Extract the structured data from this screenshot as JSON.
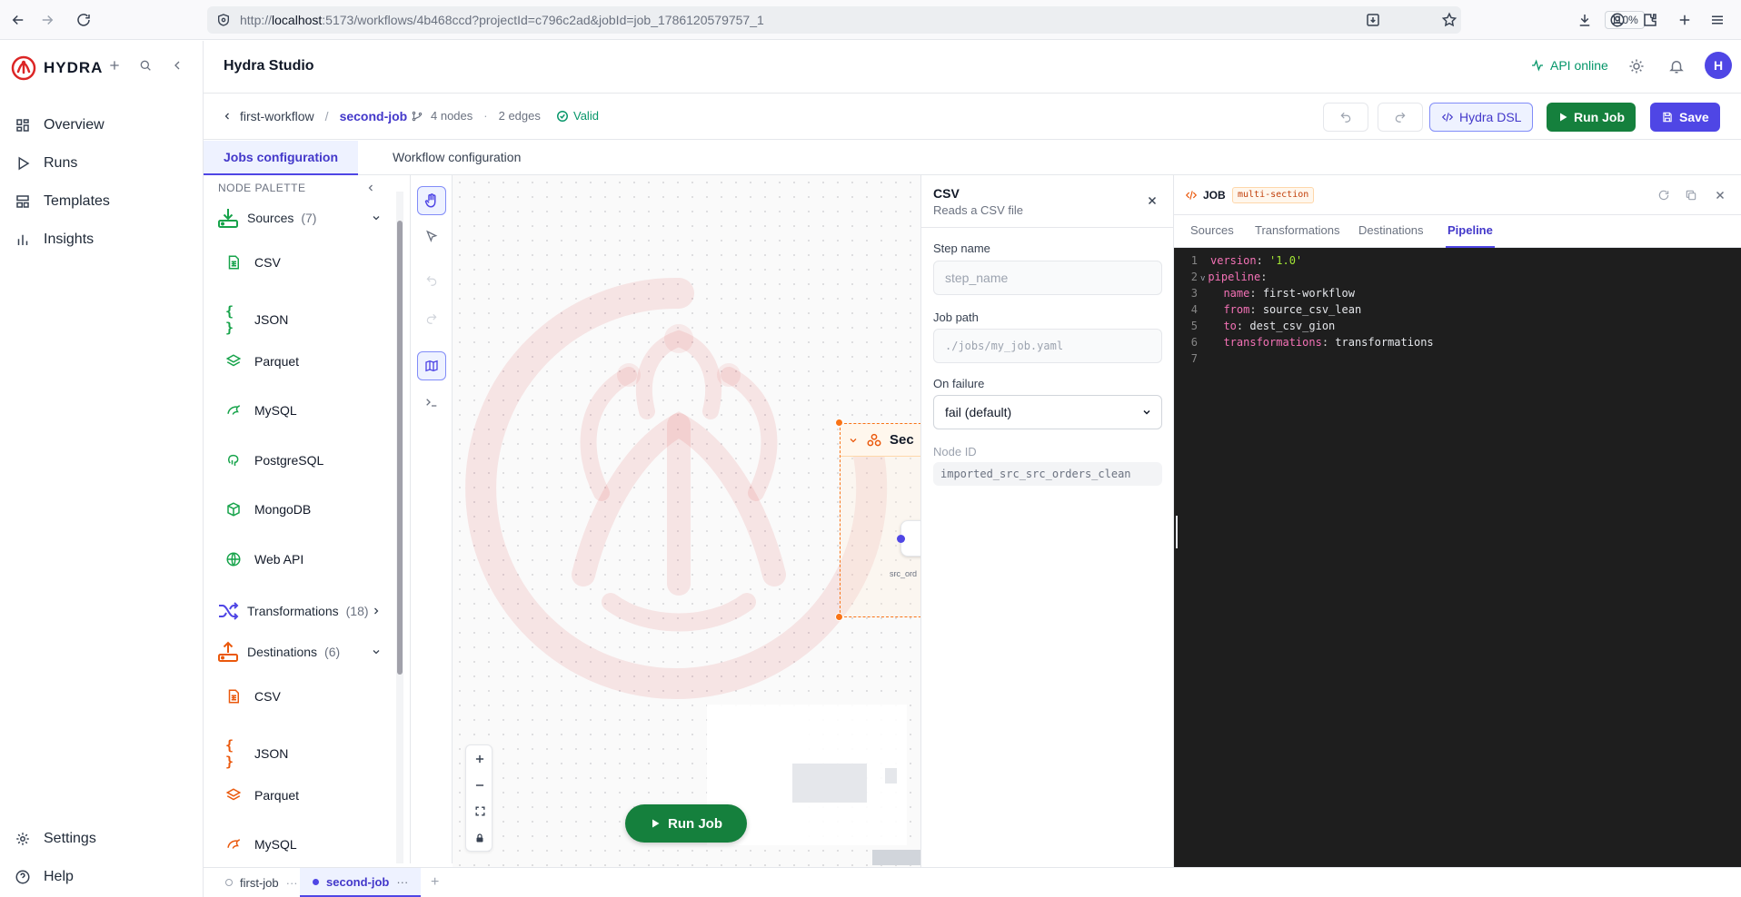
{
  "browser": {
    "url_prefix": "http://",
    "url_host": "localhost",
    "url_rest": ":5173/workflows/4b468ccd?projectId=c796c2ad&jobId=job_1786120579757_1",
    "zoom": "110%"
  },
  "sidebar": {
    "brand": "HYDRA",
    "items": [
      {
        "label": "Overview",
        "icon": "grid-icon"
      },
      {
        "label": "Runs",
        "icon": "play-icon"
      },
      {
        "label": "Templates",
        "icon": "layout-icon"
      },
      {
        "label": "Insights",
        "icon": "bar-chart-icon"
      }
    ],
    "bottom_items": [
      {
        "label": "Settings",
        "icon": "gear-icon"
      },
      {
        "label": "Help",
        "icon": "help-icon"
      }
    ]
  },
  "header": {
    "title": "Hydra Studio",
    "api_status": "API online",
    "avatar_initial": "H"
  },
  "toolbar": {
    "workflow": "first-workflow",
    "separator": "/",
    "job": "second-job",
    "nodes": "4 nodes",
    "dot": "·",
    "edges": "2 edges",
    "status": "Valid",
    "dsl_label": "Hydra DSL",
    "run_label": "Run Job",
    "save_label": "Save"
  },
  "tabs": {
    "jobs": "Jobs configuration",
    "workflow": "Workflow configuration"
  },
  "palette": {
    "title": "NODE PALETTE",
    "sources_label": "Sources",
    "sources_count": "(7)",
    "sources": [
      "CSV",
      "JSON",
      "Parquet",
      "MySQL",
      "PostgreSQL",
      "MongoDB",
      "Web API"
    ],
    "transformations_label": "Transformations",
    "transformations_count": "(18)",
    "destinations_label": "Destinations",
    "destinations_count": "(6)",
    "destinations": [
      "CSV",
      "JSON",
      "Parquet",
      "MySQL"
    ]
  },
  "canvas": {
    "group_title": "Sec",
    "inner_label": "src_ord",
    "run_label": "Run Job",
    "colors": {
      "group_border": "#f97316",
      "run_button": "#15803d"
    }
  },
  "props": {
    "title": "CSV",
    "subtitle": "Reads a CSV file",
    "step_name_label": "Step name",
    "step_name_placeholder": "step_name",
    "job_path_label": "Job path",
    "job_path_placeholder": "./jobs/my_job.yaml",
    "on_failure_label": "On failure",
    "on_failure_value": "fail (default)",
    "node_id_label": "Node ID",
    "node_id_value": "imported_src_src_orders_clean"
  },
  "code": {
    "title": "JOB",
    "badge": "multi-section",
    "tabs": [
      "Sources",
      "Transformations",
      "Destinations",
      "Pipeline"
    ],
    "active_tab": "Pipeline",
    "lines": [
      {
        "n": "1",
        "key": "version",
        "val": "'1.0'",
        "indent": ""
      },
      {
        "n": "2",
        "key": "pipeline",
        "val": "",
        "indent": ""
      },
      {
        "n": "3",
        "key": "name",
        "val": "first-workflow",
        "indent": "  "
      },
      {
        "n": "4",
        "key": "from",
        "val": "source_csv_lean",
        "indent": "  "
      },
      {
        "n": "5",
        "key": "to",
        "val": "dest_csv_gion",
        "indent": "  "
      },
      {
        "n": "6",
        "key": "transformations",
        "val": "transformations",
        "indent": "  "
      },
      {
        "n": "7",
        "key": "",
        "val": "",
        "indent": ""
      }
    ]
  },
  "bottom_tabs": {
    "tab1": "first-job",
    "tab2": "second-job",
    "more": "···",
    "add": "+"
  },
  "colors": {
    "accent": "#4f46e5",
    "success": "#059669",
    "source": "#16a34a",
    "transform": "#4f46e5",
    "destination": "#ea580c"
  }
}
